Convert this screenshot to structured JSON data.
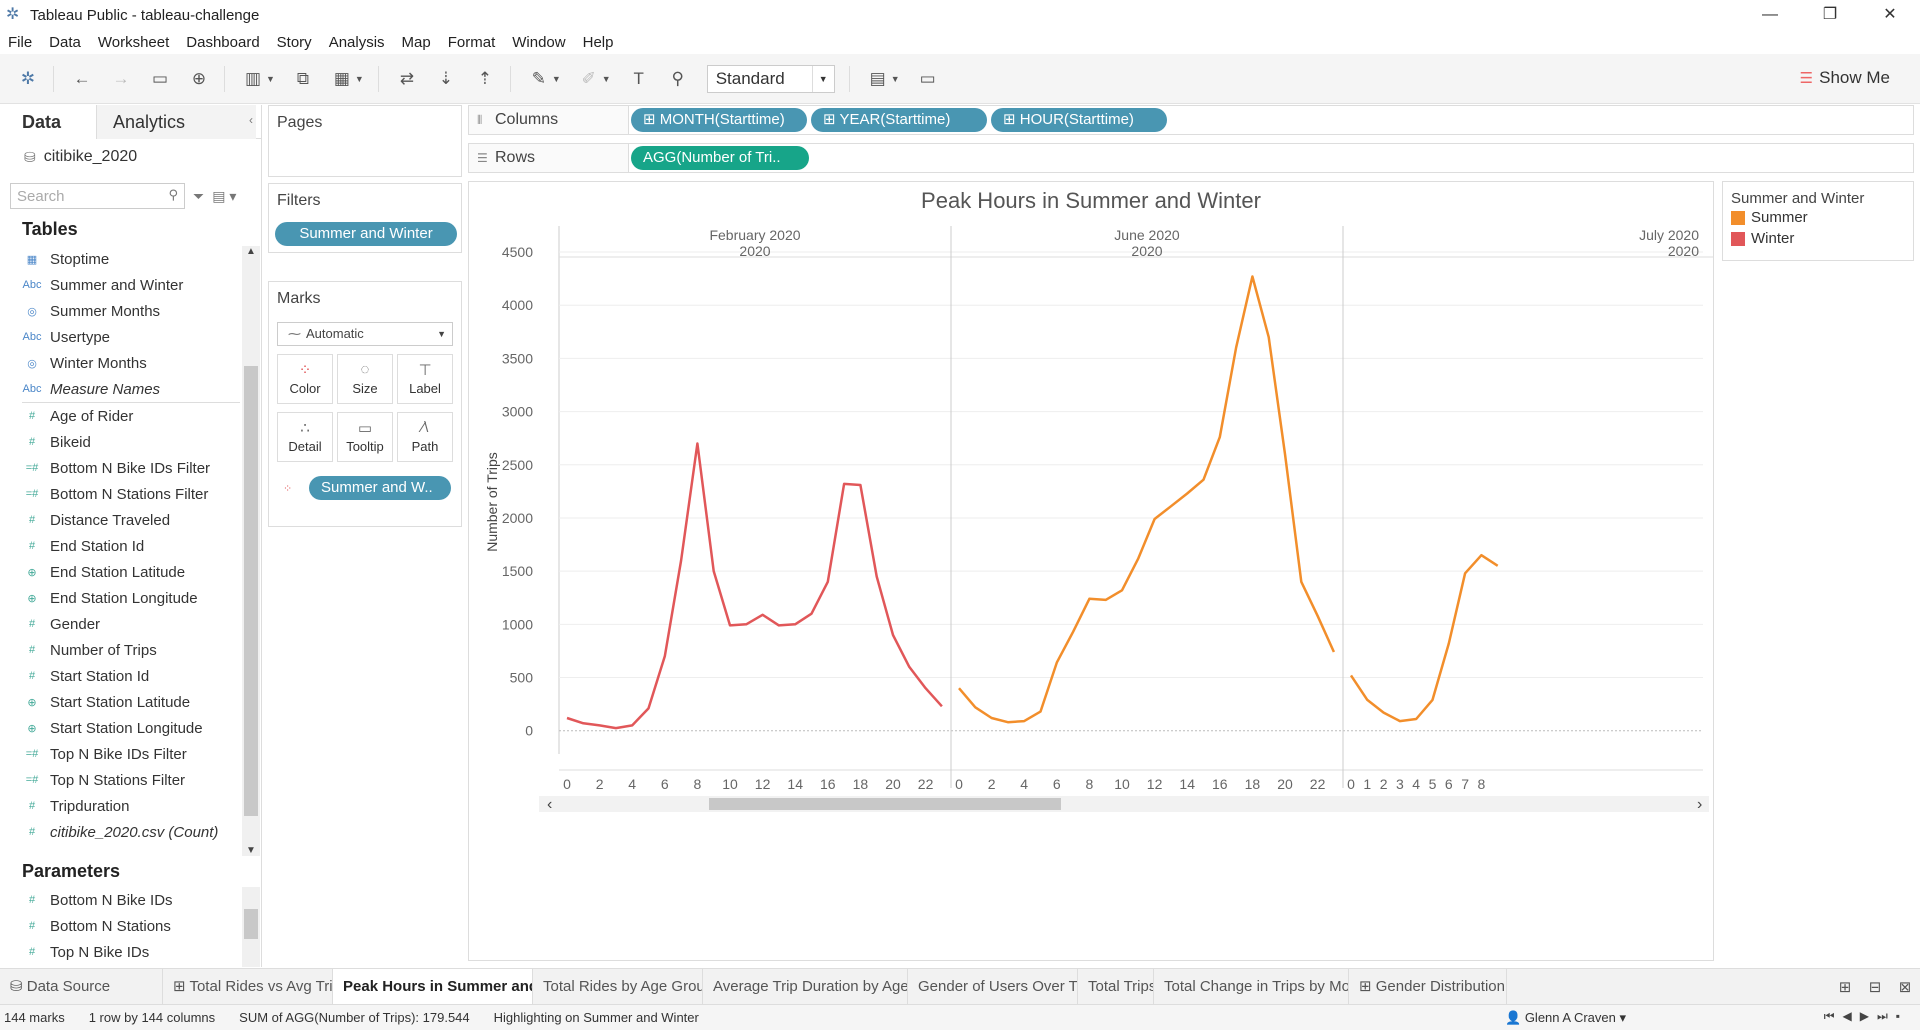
{
  "window": {
    "title": "Tableau Public - tableau-challenge",
    "controls": [
      "—",
      "❐",
      "✕"
    ]
  },
  "menu": [
    "File",
    "Data",
    "Worksheet",
    "Dashboard",
    "Story",
    "Analysis",
    "Map",
    "Format",
    "Window",
    "Help"
  ],
  "toolbar": {
    "fit_value": "Standard",
    "show_me_label": "Show Me"
  },
  "data_pane": {
    "tabs": {
      "data": "Data",
      "analytics": "Analytics"
    },
    "datasource": "citibike_2020",
    "search_placeholder": "Search",
    "tables_title": "Tables",
    "dimensions": [
      {
        "label": "Stoptime",
        "icon": "calendar-icon"
      },
      {
        "label": "Summer and Winter",
        "icon": "abc-icon"
      },
      {
        "label": "Summer Months",
        "icon": "set-icon"
      },
      {
        "label": "Usertype",
        "icon": "abc-icon"
      },
      {
        "label": "Winter Months",
        "icon": "set-icon"
      },
      {
        "label": "Measure Names",
        "icon": "abc-icon"
      }
    ],
    "measures": [
      {
        "label": "Age of Rider",
        "icon": "hash-icon"
      },
      {
        "label": "Bikeid",
        "icon": "hash-icon"
      },
      {
        "label": "Bottom N Bike IDs Filter",
        "icon": "calc-icon"
      },
      {
        "label": "Bottom N Stations Filter",
        "icon": "calc-icon"
      },
      {
        "label": "Distance Traveled",
        "icon": "hash-icon"
      },
      {
        "label": "End Station Id",
        "icon": "hash-icon"
      },
      {
        "label": "End Station Latitude",
        "icon": "globe-icon"
      },
      {
        "label": "End Station Longitude",
        "icon": "globe-icon"
      },
      {
        "label": "Gender",
        "icon": "hash-icon"
      },
      {
        "label": "Number of Trips",
        "icon": "hash-icon"
      },
      {
        "label": "Start Station Id",
        "icon": "hash-icon"
      },
      {
        "label": "Start Station Latitude",
        "icon": "globe-icon"
      },
      {
        "label": "Start Station Longitude",
        "icon": "globe-icon"
      },
      {
        "label": "Top N Bike IDs Filter",
        "icon": "calc-icon"
      },
      {
        "label": "Top N Stations Filter",
        "icon": "calc-icon"
      },
      {
        "label": "Tripduration",
        "icon": "hash-icon"
      },
      {
        "label": "citibike_2020.csv (Count)",
        "icon": "hash-icon"
      }
    ],
    "parameters_title": "Parameters",
    "parameters": [
      "Bottom N Bike IDs",
      "Bottom N Stations",
      "Top N Bike IDs"
    ]
  },
  "cards": {
    "pages": "Pages",
    "filters": "Filters",
    "filter_pill": "Summer and Winter",
    "marks": "Marks",
    "mark_type": "Automatic",
    "mark_buttons": [
      "Color",
      "Size",
      "Label",
      "Detail",
      "Tooltip",
      "Path"
    ],
    "color_pill": "Summer and W.."
  },
  "shelves": {
    "columns_label": "Columns",
    "rows_label": "Rows",
    "columns_pills": [
      "MONTH(Starttime)",
      "YEAR(Starttime)",
      "HOUR(Starttime)"
    ],
    "rows_pill": "AGG(Number of Tri.."
  },
  "legend": {
    "title": "Summer and Winter",
    "items": [
      {
        "label": "Summer",
        "color": "#f28e2b"
      },
      {
        "label": "Winter",
        "color": "#e15759"
      }
    ]
  },
  "chart_data": {
    "type": "line",
    "title": "Peak Hours in Summer and Winter",
    "ylabel": "Number of Trips",
    "ylim": [
      -200,
      4500
    ],
    "yticks": [
      0,
      500,
      1000,
      1500,
      2000,
      2500,
      3000,
      3500,
      4000,
      4500
    ],
    "panes": [
      {
        "month": "February 2020",
        "year": "2020",
        "series": "Winter",
        "color": "#e15759",
        "xticks": [
          "0",
          "2",
          "4",
          "6",
          "8",
          "10",
          "12",
          "14",
          "16",
          "18",
          "20",
          "22"
        ],
        "x": [
          0,
          1,
          2,
          3,
          4,
          5,
          6,
          7,
          8,
          9,
          10,
          11,
          12,
          13,
          14,
          15,
          16,
          17,
          18,
          19,
          20,
          21,
          22,
          23
        ],
        "values": [
          120,
          70,
          50,
          25,
          50,
          210,
          700,
          1600,
          2700,
          1500,
          990,
          1000,
          1090,
          990,
          1000,
          1100,
          1400,
          2320,
          2310,
          1450,
          900,
          600,
          400,
          230
        ]
      },
      {
        "month": "June 2020",
        "year": "2020",
        "series": "Summer",
        "color": "#f28e2b",
        "xticks": [
          "0",
          "2",
          "4",
          "6",
          "8",
          "10",
          "12",
          "14",
          "16",
          "18",
          "20",
          "22"
        ],
        "x": [
          0,
          1,
          2,
          3,
          4,
          5,
          6,
          7,
          8,
          9,
          10,
          11,
          12,
          13,
          14,
          15,
          16,
          17,
          18,
          19,
          20,
          21,
          22,
          23
        ],
        "values": [
          400,
          220,
          120,
          80,
          90,
          180,
          640,
          930,
          1240,
          1230,
          1320,
          1620,
          1990,
          2110,
          2230,
          2360,
          2760,
          3600,
          4270,
          3700,
          2600,
          1400,
          1080,
          740
        ]
      },
      {
        "month": "July 2020",
        "year": "2020",
        "series": "Summer",
        "color": "#f28e2b",
        "xticks": [
          "0",
          "1",
          "2",
          "3",
          "4",
          "5",
          "6",
          "7",
          "8"
        ],
        "x": [
          0,
          1,
          2,
          3,
          4,
          5,
          6,
          7,
          8,
          9
        ],
        "values": [
          520,
          290,
          170,
          90,
          110,
          290,
          820,
          1480,
          1650,
          1550
        ]
      }
    ]
  },
  "sheet_tabs": [
    {
      "label": "Data Source",
      "icon": "datasource-icon",
      "active": false
    },
    {
      "label": "Total Rides vs Avg Trip Durati...",
      "icon": "grid-icon",
      "active": false
    },
    {
      "label": "Peak Hours in Summer and Wi...",
      "icon": "",
      "active": true
    },
    {
      "label": "Total  Rides by Age Groups",
      "icon": "",
      "active": false
    },
    {
      "label": "Average Trip Duration by Age Gr...",
      "icon": "",
      "active": false
    },
    {
      "label": "Gender of Users Over Time",
      "icon": "",
      "active": false
    },
    {
      "label": "Total Trips",
      "icon": "",
      "active": false
    },
    {
      "label": "Total Change in Trips by Month",
      "icon": "",
      "active": false
    },
    {
      "label": "Gender Distribution",
      "icon": "grid-icon",
      "active": false
    }
  ],
  "status": {
    "marks": "144 marks",
    "dims": "1 row by 144 columns",
    "sum": "SUM of AGG(Number of Trips): 179.544",
    "highlight": "Highlighting on Summer and Winter",
    "user": "Glenn A Craven"
  }
}
